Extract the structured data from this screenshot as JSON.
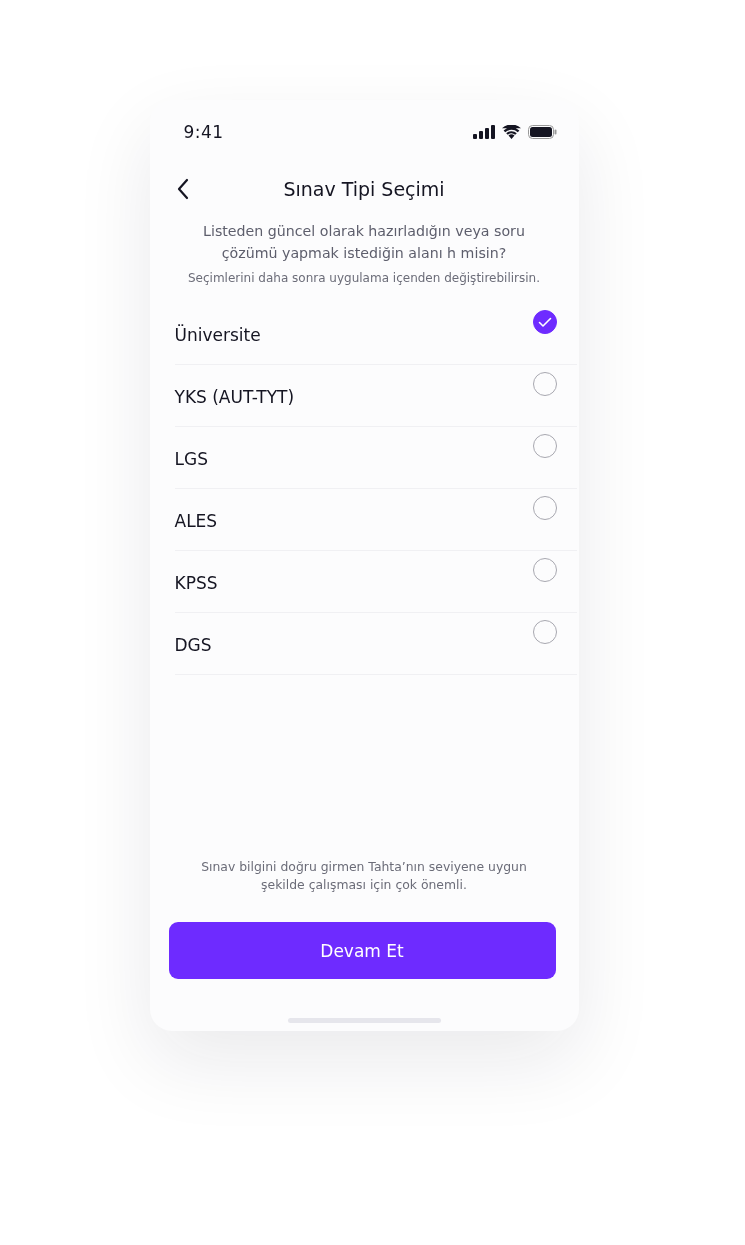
{
  "status_bar": {
    "time": "9:41"
  },
  "header": {
    "title": "Sınav Tipi Seçimi"
  },
  "description": "Listeden güncel olarak hazırladığın veya soru çözümü yapmak istediğin alanı h misin?",
  "hint": "Seçimlerini daha sonra uygulama içenden değiştirebilirsin.",
  "options": [
    {
      "label": "Üniversite",
      "selected": true
    },
    {
      "label": "YKS (AUT-TYT)",
      "selected": false
    },
    {
      "label": "LGS",
      "selected": false
    },
    {
      "label": "ALES",
      "selected": false
    },
    {
      "label": "KPSS",
      "selected": false
    },
    {
      "label": "DGS",
      "selected": false
    }
  ],
  "footer_note": "Sınav bilgini doğru girmen Tahta’nın seviyene uygun şekilde çalışması için çok önemli.",
  "primary_button": "Devam Et"
}
